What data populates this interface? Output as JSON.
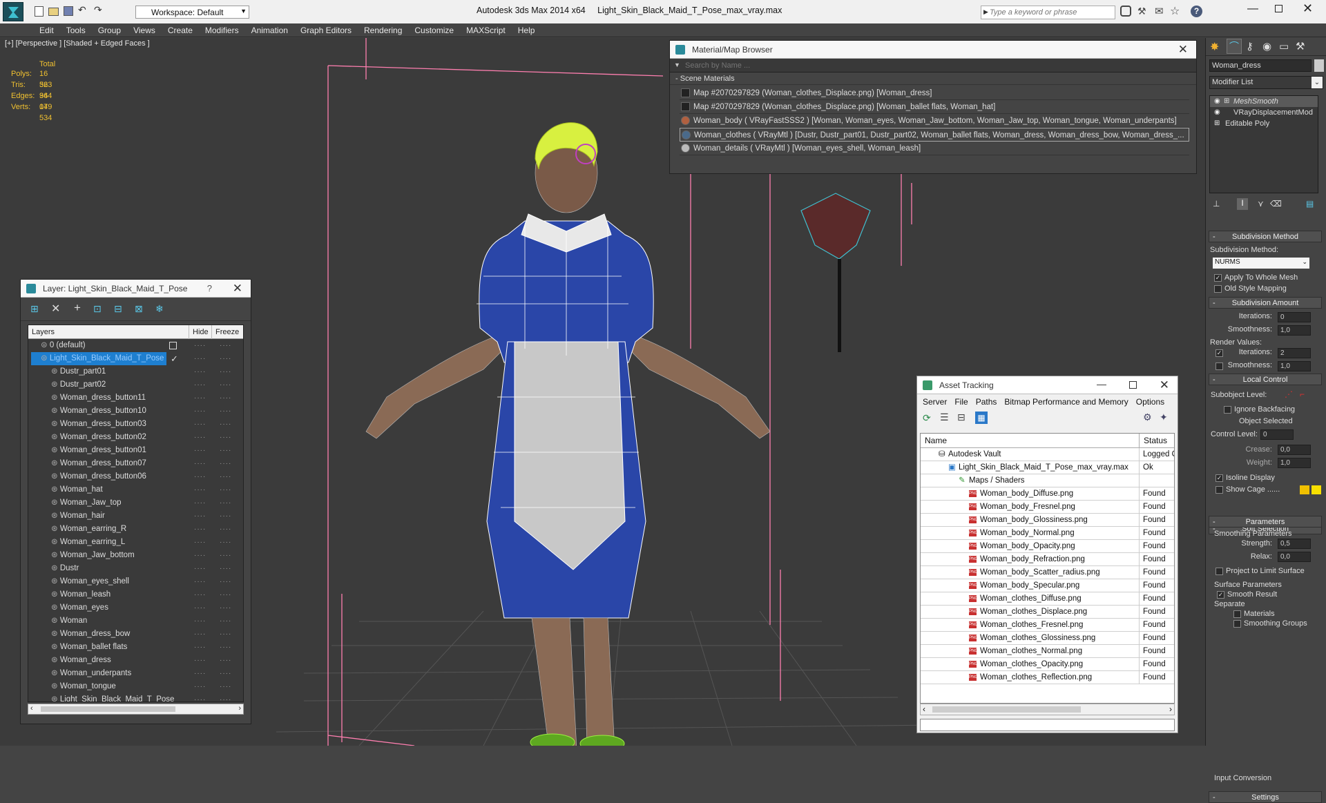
{
  "titlebar": {
    "app_title": "Autodesk 3ds Max  2014 x64",
    "file_title": "Light_Skin_Black_Maid_T_Pose_max_vray.max",
    "workspace": "Workspace: Default",
    "search_placeholder": "Type a keyword or phrase"
  },
  "menu": [
    "Edit",
    "Tools",
    "Group",
    "Views",
    "Create",
    "Modifiers",
    "Animation",
    "Graph Editors",
    "Rendering",
    "Customize",
    "MAXScript",
    "Help"
  ],
  "viewport": {
    "label": "[+] [Perspective ] [Shaded + Edged Faces ]",
    "stats_header": "Total",
    "stats": [
      {
        "label": "Polys:",
        "value": "16 563"
      },
      {
        "label": "Tris:",
        "value": "32 964"
      },
      {
        "label": "Edges:",
        "value": "34 049"
      },
      {
        "label": "Verts:",
        "value": "17 534"
      }
    ]
  },
  "material_browser": {
    "title": "Material/Map Browser",
    "search_placeholder": "Search by Name ...",
    "group": "Scene Materials",
    "items": [
      "Map #2070297829 (Woman_clothes_Displace.png) [Woman_dress]",
      "Map #2070297829 (Woman_clothes_Displace.png) [Woman_ballet flats, Woman_hat]",
      "Woman_body  ( VRayFastSSS2 ) [Woman, Woman_eyes, Woman_Jaw_bottom, Woman_Jaw_top, Woman_tongue, Woman_underpants]",
      "Woman_clothes  ( VRayMtl ) [Dustr, Dustr_part01, Dustr_part02, Woman_ballet flats, Woman_dress, Woman_dress_bow, Woman_dress_...",
      "Woman_details  ( VRayMtl ) [Woman_eyes_shell, Woman_leash]"
    ]
  },
  "layer_panel": {
    "title": "Layer: Light_Skin_Black_Maid_T_Pose",
    "help": "?",
    "col_layers": "Layers",
    "col_hide": "Hide",
    "col_freeze": "Freeze",
    "default_layer": "0 (default)",
    "active_layer": "Light_Skin_Black_Maid_T_Pose",
    "objects": [
      "Dustr_part01",
      "Dustr_part02",
      "Woman_dress_button11",
      "Woman_dress_button10",
      "Woman_dress_button03",
      "Woman_dress_button02",
      "Woman_dress_button01",
      "Woman_dress_button07",
      "Woman_dress_button06",
      "Woman_hat",
      "Woman_Jaw_top",
      "Woman_hair",
      "Woman_earring_R",
      "Woman_earring_L",
      "Woman_Jaw_bottom",
      "Dustr",
      "Woman_eyes_shell",
      "Woman_leash",
      "Woman_eyes",
      "Woman",
      "Woman_dress_bow",
      "Woman_ballet flats",
      "Woman_dress",
      "Woman_underpants",
      "Woman_tongue",
      "Light_Skin_Black_Maid_T_Pose"
    ]
  },
  "asset_tracking": {
    "title": "Asset Tracking",
    "menu": [
      "Server",
      "File",
      "Paths",
      "Bitmap Performance and Memory",
      "Options"
    ],
    "col_name": "Name",
    "col_status": "Status",
    "vault": {
      "name": "Autodesk Vault",
      "status": "Logged O"
    },
    "file": {
      "name": "Light_Skin_Black_Maid_T_Pose_max_vray.max",
      "status": "Ok"
    },
    "maps_group": "Maps / Shaders",
    "maps": [
      {
        "name": "Woman_body_Diffuse.png",
        "status": "Found"
      },
      {
        "name": "Woman_body_Fresnel.png",
        "status": "Found"
      },
      {
        "name": "Woman_body_Glossiness.png",
        "status": "Found"
      },
      {
        "name": "Woman_body_Normal.png",
        "status": "Found"
      },
      {
        "name": "Woman_body_Opacity.png",
        "status": "Found"
      },
      {
        "name": "Woman_body_Refraction.png",
        "status": "Found"
      },
      {
        "name": "Woman_body_Scatter_radius.png",
        "status": "Found"
      },
      {
        "name": "Woman_body_Specular.png",
        "status": "Found"
      },
      {
        "name": "Woman_clothes_Diffuse.png",
        "status": "Found"
      },
      {
        "name": "Woman_clothes_Displace.png",
        "status": "Found"
      },
      {
        "name": "Woman_clothes_Fresnel.png",
        "status": "Found"
      },
      {
        "name": "Woman_clothes_Glossiness.png",
        "status": "Found"
      },
      {
        "name": "Woman_clothes_Normal.png",
        "status": "Found"
      },
      {
        "name": "Woman_clothes_Opacity.png",
        "status": "Found"
      },
      {
        "name": "Woman_clothes_Reflection.png",
        "status": "Found"
      }
    ]
  },
  "command_panel": {
    "object_name": "Woman_dress",
    "modifier_list": "Modifier List",
    "stack": [
      "MeshSmooth",
      "VRayDisplacementMod",
      "Editable Poly"
    ],
    "subdivision_method": {
      "header": "Subdivision Method",
      "label": "Subdivision Method:",
      "value": "NURMS",
      "apply_whole_mesh": "Apply To Whole Mesh",
      "old_style": "Old Style Mapping"
    },
    "subdivision_amount": {
      "header": "Subdivision Amount",
      "iterations_label": "Iterations:",
      "iterations": "0",
      "smoothness_label": "Smoothness:",
      "smoothness": "1,0",
      "render_values": "Render Values:",
      "r_iterations_label": "Iterations:",
      "r_iterations": "2",
      "r_smoothness_label": "Smoothness:",
      "r_smoothness": "1,0"
    },
    "local_control": {
      "header": "Local Control",
      "subobject_level": "Subobject Level:",
      "ignore_backfacing": "Ignore Backfacing",
      "object_selected": "Object Selected",
      "control_level_label": "Control Level:",
      "control_level": "0",
      "crease_label": "Crease:",
      "crease": "0,0",
      "weight_label": "Weight:",
      "weight": "1,0",
      "isoline": "Isoline Display",
      "show_cage": "Show Cage ......"
    },
    "soft_selection": "Soft Selection",
    "parameters": {
      "header": "Parameters",
      "smoothing": "Smoothing Parameters",
      "strength_label": "Strength:",
      "strength": "0,5",
      "relax_label": "Relax:",
      "relax": "0,0",
      "project": "Project to Limit Surface",
      "surface": "Surface Parameters",
      "smooth_result": "Smooth Result",
      "separate": "Separate",
      "materials": "Materials",
      "smoothing_groups": "Smoothing Groups"
    },
    "settings": "Settings",
    "input_conversion": "Input Conversion"
  },
  "colors": {
    "accent": "#1e7fd0",
    "dress": "#2a46a8",
    "hat": "#d8f040",
    "stats": "#f0c030",
    "cage1": "#f0c000",
    "cage2": "#f8e000"
  }
}
